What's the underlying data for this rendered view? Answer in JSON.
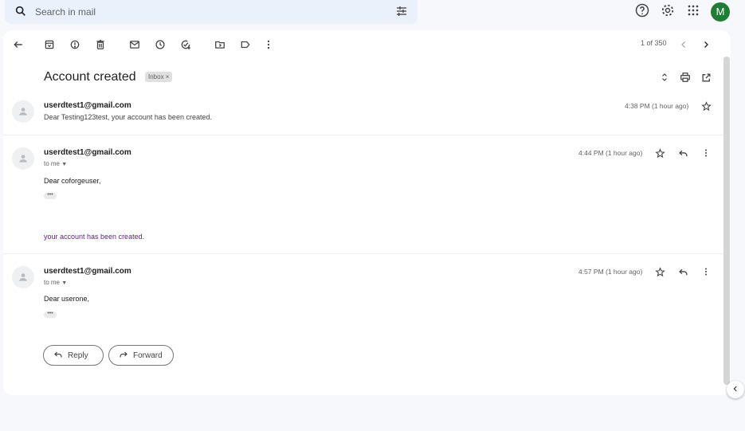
{
  "search": {
    "placeholder": "Search in mail"
  },
  "user": {
    "avatar_letter": "M",
    "avatar_color": "#1e7e34"
  },
  "toolbar": {
    "pager": "1 of 350"
  },
  "thread": {
    "subject": "Account created",
    "label": "Inbox ×",
    "messages": [
      {
        "sender": "userdtest1@gmail.com",
        "time": "4:38 PM (1 hour ago)",
        "snippet": "Dear Testing123test, your account has been created."
      },
      {
        "sender": "userdtest1@gmail.com",
        "to": "to me",
        "time": "4:44 PM (1 hour ago)",
        "greeting": "Dear coforgeuser,",
        "dots": "•••",
        "body": "your account has been created."
      },
      {
        "sender": "userdtest1@gmail.com",
        "to": "to me",
        "time": "4:57 PM (1 hour ago)",
        "greeting": "Dear userone,",
        "dots": "•••"
      }
    ]
  },
  "actions": {
    "reply": "Reply",
    "forward": "Forward"
  },
  "icons": {
    "search": "search-icon",
    "filter": "tune-icon",
    "help": "help-icon",
    "settings": "gear-icon",
    "apps": "apps-grid-icon",
    "back": "arrow-back-icon",
    "archive": "archive-icon",
    "spam": "report-spam-icon",
    "delete": "trash-icon",
    "unread": "mail-icon",
    "snooze": "clock-icon",
    "task": "add-task-icon",
    "move": "folder-move-icon",
    "label": "label-icon",
    "more": "more-vert-icon"
  }
}
